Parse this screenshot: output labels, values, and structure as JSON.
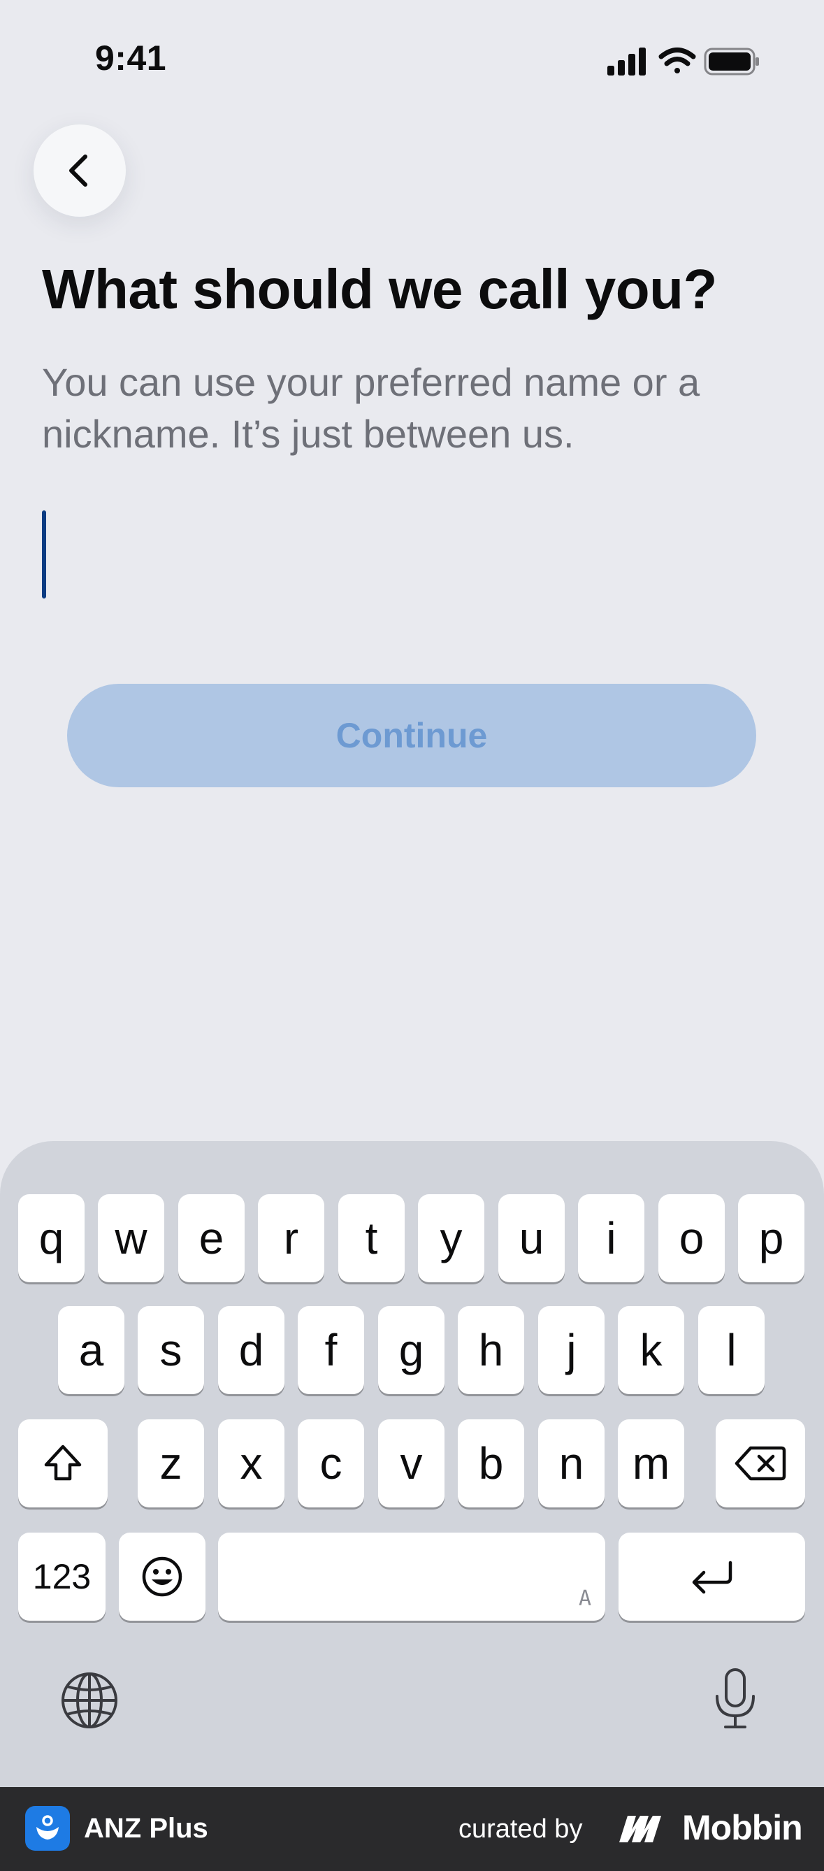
{
  "status_bar": {
    "time": "9:41",
    "icons": [
      "cellular-signal-icon",
      "wifi-icon",
      "battery-icon"
    ]
  },
  "header": {
    "back_icon": "chevron-left-icon"
  },
  "content": {
    "title": "What should we call you?",
    "subtitle": "You can use your preferred name or a nickname. It’s just between us.",
    "name_input": {
      "value": "",
      "placeholder": ""
    },
    "continue_label": "Continue",
    "continue_enabled": false
  },
  "keyboard": {
    "row1": [
      "q",
      "w",
      "e",
      "r",
      "t",
      "y",
      "u",
      "i",
      "o",
      "p"
    ],
    "row2": [
      "a",
      "s",
      "d",
      "f",
      "g",
      "h",
      "j",
      "k",
      "l"
    ],
    "row3": [
      "z",
      "x",
      "c",
      "v",
      "b",
      "n",
      "m"
    ],
    "numbers_label": "123",
    "space_hint": "A",
    "icons": {
      "shift": "shift-icon",
      "delete": "delete-icon",
      "emoji": "emoji-icon",
      "return": "return-icon",
      "globe": "globe-icon",
      "mic": "microphone-icon"
    }
  },
  "branding": {
    "app_name": "ANZ Plus",
    "curated_by": "curated by",
    "mobbin_name": "Mobbin"
  },
  "colors": {
    "background": "#E9EAEF",
    "caret": "#0B3C82",
    "continue_bg_disabled": "#AFC6E4",
    "continue_text_disabled": "#6D9AD2",
    "keyboard_bg": "#D1D4DB",
    "brand_bar": "#2A2A2C",
    "anz_blue": "#1E7BE4"
  }
}
